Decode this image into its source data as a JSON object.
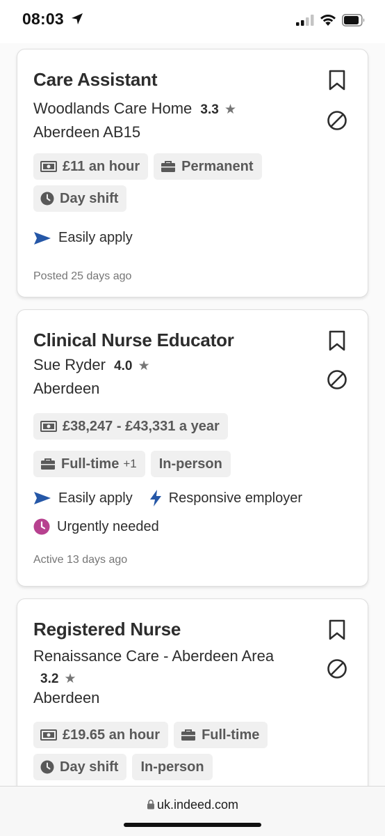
{
  "status_bar": {
    "time": "08:03"
  },
  "colors": {
    "accent_blue": "#2557a7",
    "urgent_pink": "#b7418f",
    "text": "#2d2d2d",
    "muted": "#767676",
    "tag_bg": "#f0f0f0"
  },
  "jobs": [
    {
      "title": "Care Assistant",
      "company": "Woodlands Care Home",
      "rating": "3.3",
      "location": "Aberdeen AB15",
      "tags": [
        {
          "icon": "money-icon",
          "label": "£11 an hour"
        },
        {
          "icon": "briefcase-icon",
          "label": "Permanent"
        },
        {
          "icon": "clock-icon",
          "label": "Day shift"
        }
      ],
      "perks": [
        {
          "icon": "send-arrow-icon",
          "label": "Easily apply"
        }
      ],
      "posted": "Posted 25 days ago"
    },
    {
      "title": "Clinical Nurse Educator",
      "company": "Sue Ryder",
      "rating": "4.0",
      "location": "Aberdeen",
      "tags": [
        {
          "icon": "money-icon",
          "label": "£38,247 - £43,331 a year"
        },
        {
          "icon": "briefcase-icon",
          "label": "Full-time",
          "extra": "+1"
        },
        {
          "icon": "",
          "label": "In-person"
        }
      ],
      "perks": [
        {
          "icon": "send-arrow-icon",
          "label": "Easily apply"
        },
        {
          "icon": "lightning-icon",
          "label": "Responsive employer"
        },
        {
          "icon": "clock-urgent-icon",
          "label": "Urgently needed"
        }
      ],
      "posted": "Active 13 days ago"
    },
    {
      "title": "Registered Nurse",
      "company": "Renaissance Care - Aberdeen Area",
      "rating": "3.2",
      "location": "Aberdeen",
      "tags": [
        {
          "icon": "money-icon",
          "label": "£19.65 an hour"
        },
        {
          "icon": "briefcase-icon",
          "label": "Full-time"
        },
        {
          "icon": "clock-icon",
          "label": "Day shift"
        },
        {
          "icon": "",
          "label": "In-person"
        }
      ]
    }
  ],
  "browser": {
    "url": "uk.indeed.com"
  }
}
